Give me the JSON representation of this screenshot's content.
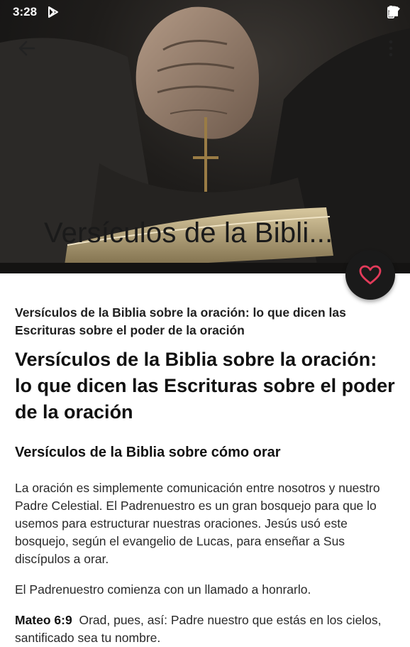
{
  "status_bar": {
    "time": "3:28"
  },
  "hero": {
    "title": "Versículos de la Bibli..."
  },
  "article": {
    "subtitle": "Versículos de la Biblia sobre la oración: lo que dicen las Escrituras sobre el poder de la oración",
    "heading": "Versículos de la Biblia sobre la oración: lo que dicen las Escrituras sobre el poder de la oración",
    "subheading": "Versículos de la Biblia sobre cómo orar",
    "paragraph1": "La oración es simplemente comunicación entre nosotros y nuestro Padre Celestial. El Padrenuestro es un gran bosquejo para que lo usemos para estructurar nuestras oraciones. Jesús usó este bosquejo, según el evangelio de Lucas, para enseñar a Sus discípulos a orar.",
    "paragraph2": "El Padrenuestro comienza con un llamado a honrarlo.",
    "verse_ref": "Mateo 6:9",
    "verse_text": "Orad, pues, así: Padre nuestro que estás en los cielos, santificado sea tu nombre."
  },
  "icons": {
    "back": "arrow-back-icon",
    "menu": "more-vert-icon",
    "favorite": "heart-outline-icon"
  },
  "colors": {
    "fab_background": "#1a1a1a",
    "heart": "#e23b5a"
  }
}
